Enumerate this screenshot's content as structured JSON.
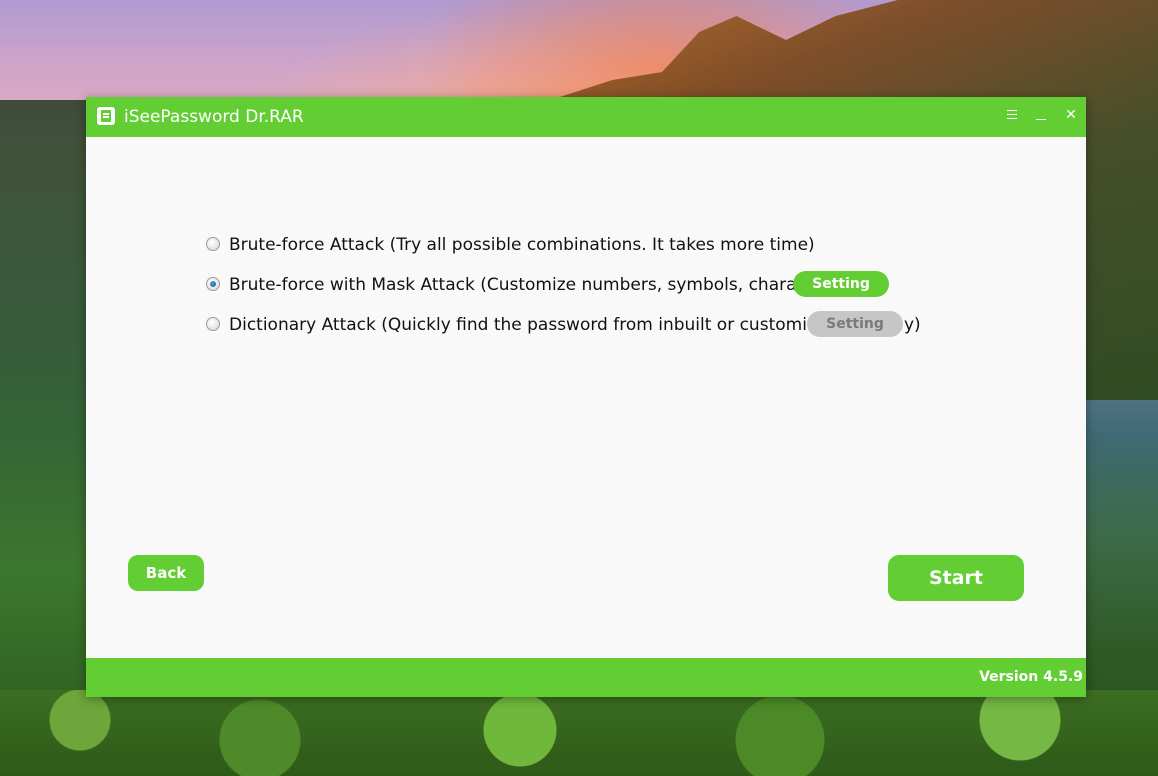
{
  "window": {
    "title": "iSeePassword Dr.RAR",
    "menu_icon": "hamburger-icon",
    "minimize_icon": "minimize-icon",
    "close_icon": "close-icon",
    "close_glyph": "✕",
    "app_icon": "rar-document-icon"
  },
  "options": [
    {
      "label": "Brute-force Attack (Try all possible combinations. It takes more time)",
      "selected": false
    },
    {
      "label": "Brute-force with Mask Attack (Customize numbers, symbols, characters)",
      "selected": true,
      "setting_label": "Setting",
      "setting_enabled": true
    },
    {
      "label": "Dictionary Attack (Quickly find the password from inbuilt or customized dictionary)",
      "selected": false,
      "setting_label": "Setting",
      "setting_enabled": false
    }
  ],
  "buttons": {
    "back_label": "Back",
    "start_label": "Start"
  },
  "footer": {
    "version": "Version 4.5.9"
  },
  "colors": {
    "brand_green": "#63ce34",
    "background": "#f9f9f9",
    "disabled_gray": "#c6c6c6"
  }
}
